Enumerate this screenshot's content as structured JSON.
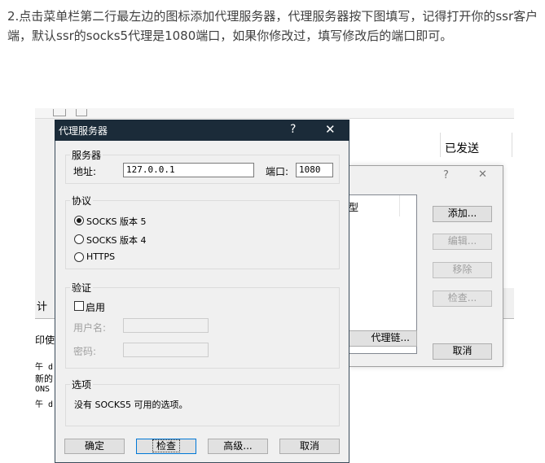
{
  "instruction": "2.点击菜单栏第二行最左边的图标添加代理服务器，代理服务器按下图填写，记得打开你的ssr客户端，默认ssr的socks5代理是1080端口，如果你修改过，填写修改后的端口即可。",
  "background_window": {
    "sent_column": "已发送",
    "partial_left_texts": [
      "计",
      "印使",
      "午 d",
      "新的",
      "ONS :",
      "午 d"
    ]
  },
  "proxy_list_dialog": {
    "help": "?",
    "close": "✕",
    "column_header": "型",
    "add_label": "添加...",
    "edit_label": "编辑...",
    "remove_label": "移除",
    "check_label": "检查...",
    "chain_label": "代理链...",
    "cancel_label": "取消"
  },
  "proxy_dialog": {
    "title": "代理服务器",
    "help": "?",
    "close": "✕",
    "server_group": "服务器",
    "address_label": "地址:",
    "address_value": "127.0.0.1",
    "port_label": "端口:",
    "port_value": "1080",
    "protocol_group": "协议",
    "protocols": [
      "SOCKS 版本 5",
      "SOCKS 版本 4",
      "HTTPS"
    ],
    "selected_protocol": "SOCKS 版本 5",
    "auth_group": "验证",
    "enable_label": "启用",
    "username_label": "用户名:",
    "password_label": "密码:",
    "options_group": "选项",
    "options_text": "没有 SOCKS5 可用的选项。",
    "ok_label": "确定",
    "check_label": "检查",
    "advanced_label": "高级...",
    "cancel_label": "取消"
  },
  "colors": {
    "titlebar": "#1b2b39",
    "dialog_bg": "#f0f0f0",
    "text": "#3f3f3f"
  }
}
